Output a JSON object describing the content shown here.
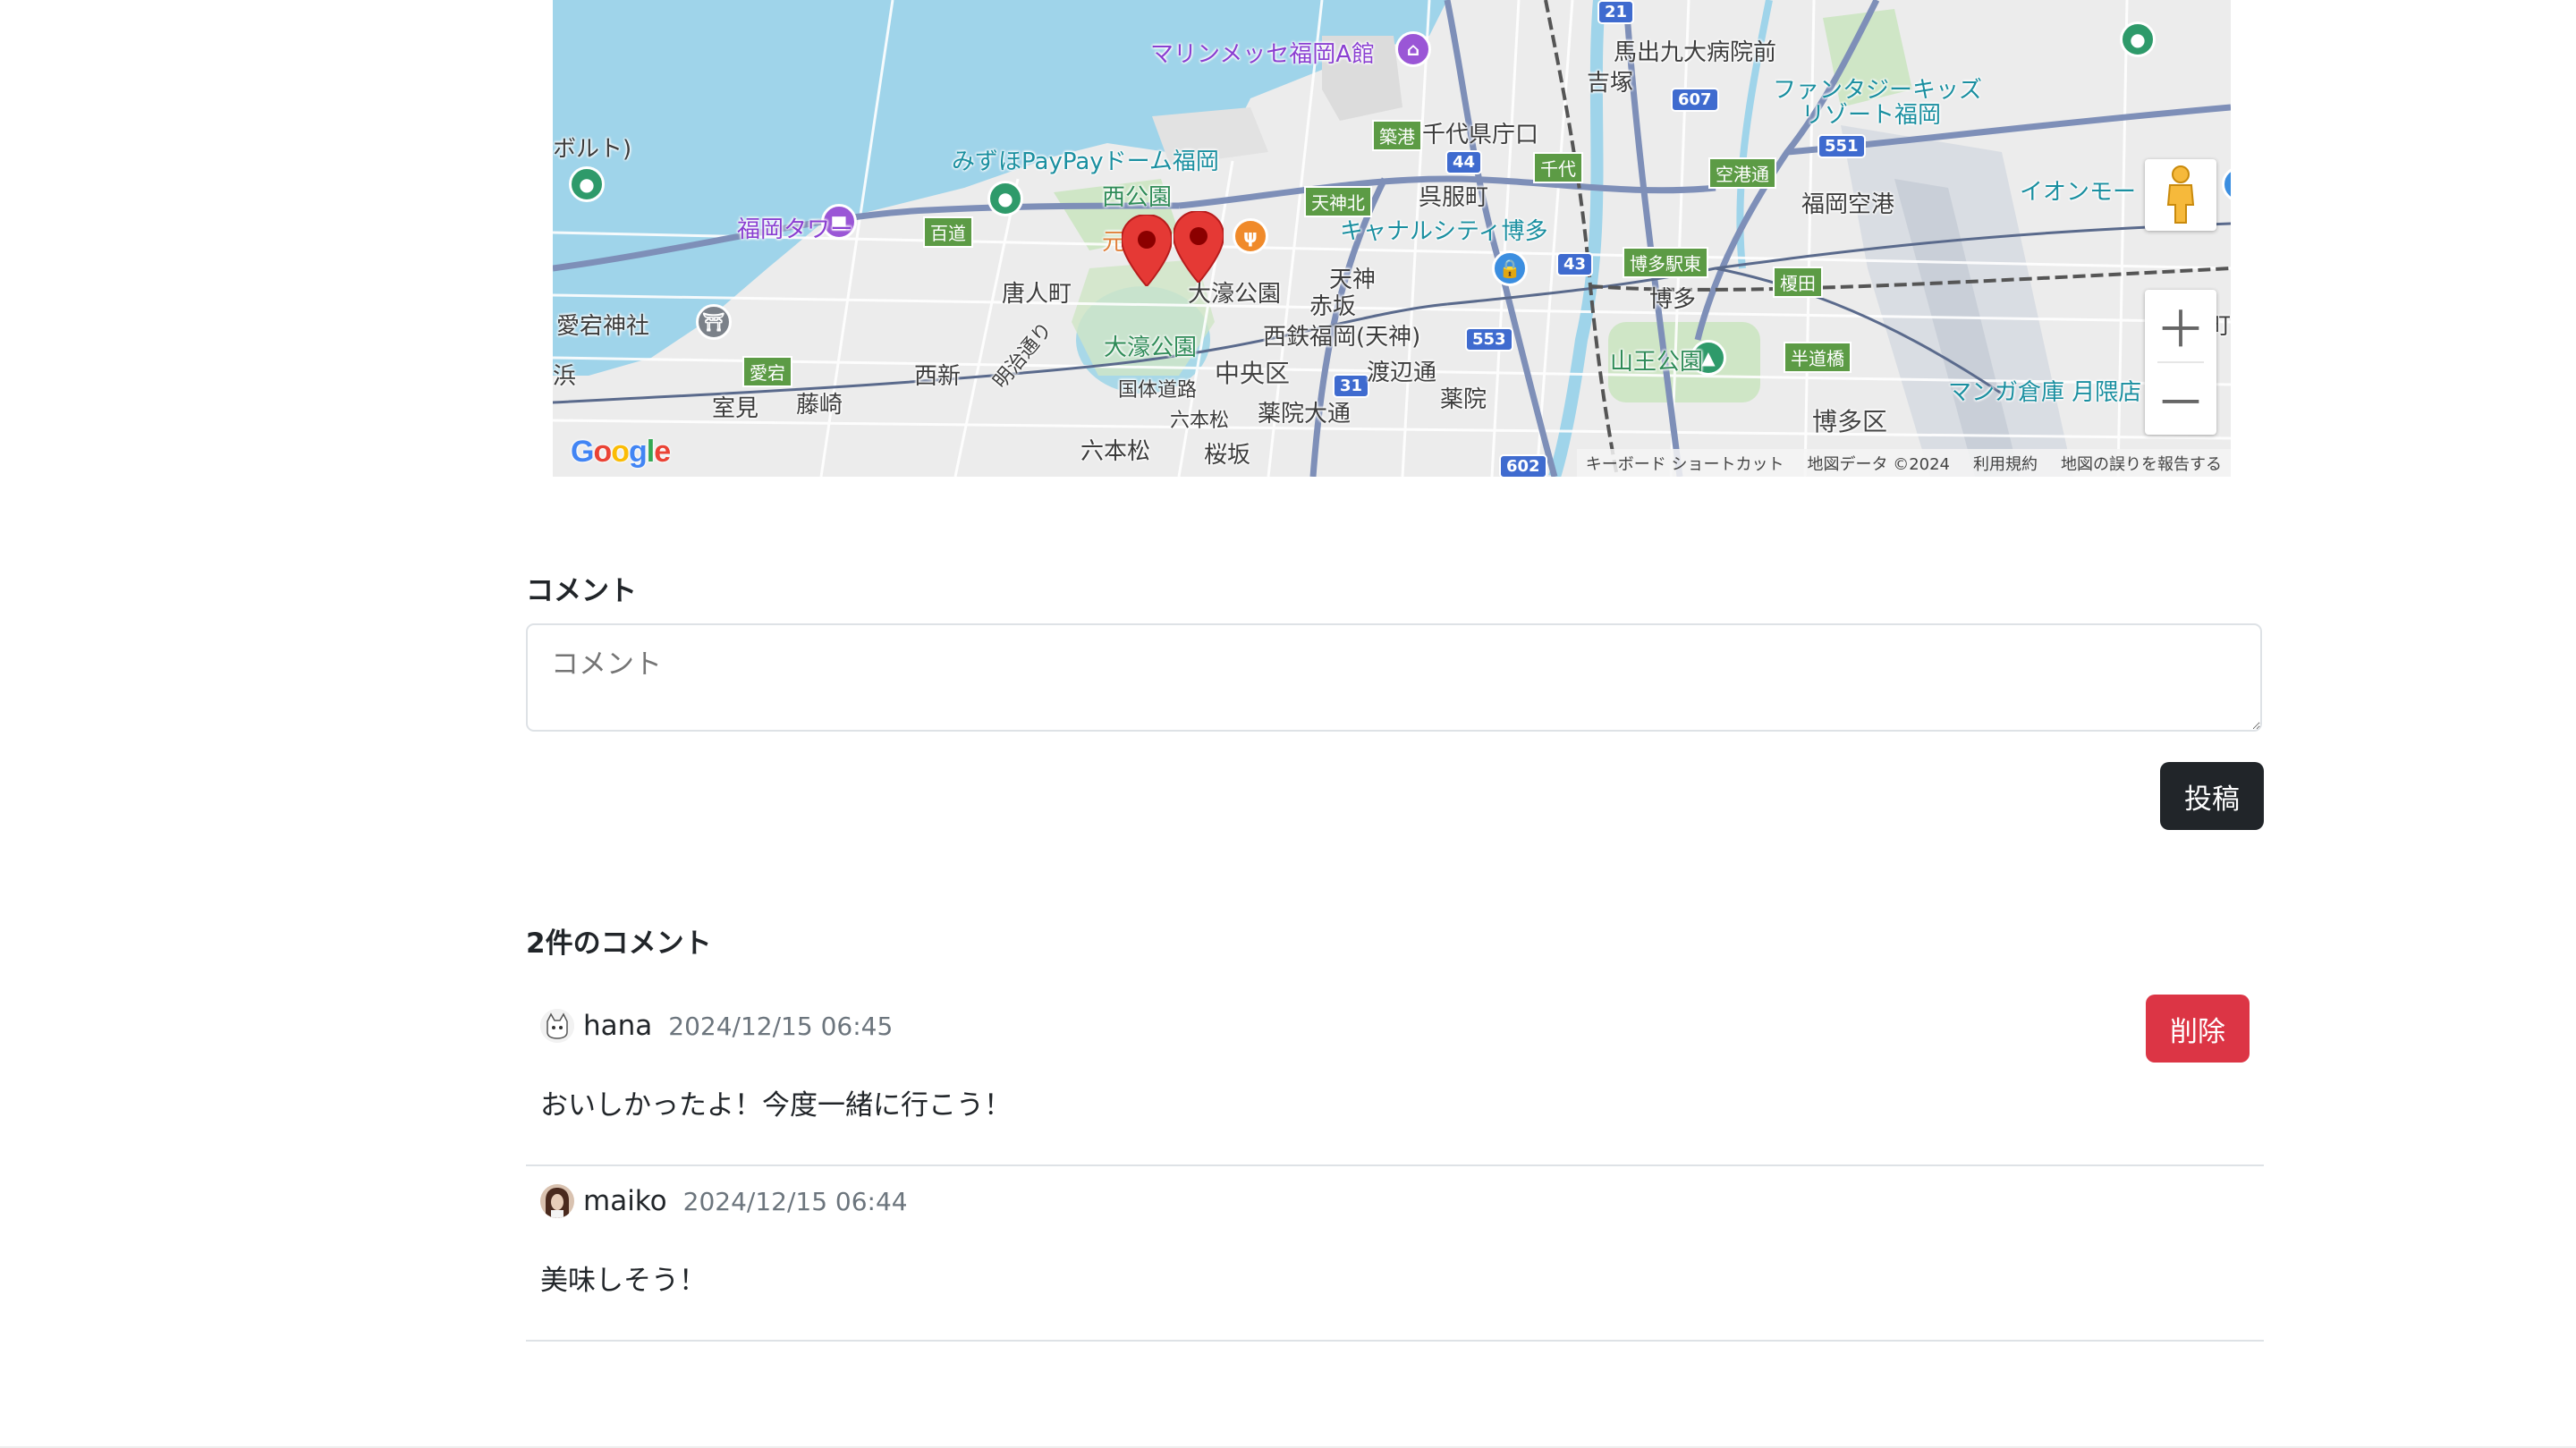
{
  "map": {
    "labels": [
      {
        "text": "マリンメッセ福岡A館",
        "cls": "purple"
      },
      {
        "text": "馬出九大病院前",
        "cls": ""
      },
      {
        "text": "吉塚",
        "cls": ""
      },
      {
        "text": "ファンタジーキッズ",
        "cls": "teal"
      },
      {
        "text": "リゾート福岡",
        "cls": "teal"
      },
      {
        "text": "みずほPayPayドーム福岡",
        "cls": "teal"
      },
      {
        "text": "千代県庁口",
        "cls": ""
      },
      {
        "text": "福岡タワー",
        "cls": "purple"
      },
      {
        "text": "西公園",
        "cls": "green"
      },
      {
        "text": "呉服町",
        "cls": ""
      },
      {
        "text": "福岡空港",
        "cls": ""
      },
      {
        "text": "イオンモー",
        "cls": "teal"
      },
      {
        "text": "キャナルシティ博多",
        "cls": "teal"
      },
      {
        "text": "天神",
        "cls": ""
      },
      {
        "text": "唐人町",
        "cls": ""
      },
      {
        "text": "大濠公園",
        "cls": ""
      },
      {
        "text": "赤坂",
        "cls": ""
      },
      {
        "text": "博多",
        "cls": ""
      },
      {
        "text": "西鉄福岡(天神)",
        "cls": ""
      },
      {
        "text": "大濠公園",
        "cls": "green"
      },
      {
        "text": "中央区",
        "cls": "big"
      },
      {
        "text": "渡辺通",
        "cls": ""
      },
      {
        "text": "西新",
        "cls": ""
      },
      {
        "text": "山王公園",
        "cls": "green"
      },
      {
        "text": "国体道路",
        "cls": "small"
      },
      {
        "text": "薬院",
        "cls": ""
      },
      {
        "text": "藤崎",
        "cls": ""
      },
      {
        "text": "室見",
        "cls": ""
      },
      {
        "text": "薬院大通",
        "cls": ""
      },
      {
        "text": "マンガ倉庫 月隈店",
        "cls": "teal"
      },
      {
        "text": "六本松",
        "cls": ""
      },
      {
        "text": "桜坂",
        "cls": ""
      },
      {
        "text": "博多区",
        "cls": "big"
      },
      {
        "text": "愛宕神社",
        "cls": ""
      },
      {
        "text": "浜",
        "cls": ""
      },
      {
        "text": "ボルト)",
        "cls": ""
      },
      {
        "text": "元",
        "cls": ""
      },
      {
        "text": "町",
        "cls": ""
      },
      {
        "text": "明治通り",
        "cls": "small"
      },
      {
        "text": "六本松",
        "cls": "small"
      }
    ],
    "station_tags": [
      "築港",
      "天神北",
      "千代",
      "空港通",
      "博多駅東",
      "榎田",
      "半道橋",
      "百道",
      "愛宕"
    ],
    "routes": [
      "21",
      "607",
      "44",
      "551",
      "43",
      "553",
      "31",
      "602"
    ],
    "google_logo": "Google",
    "footer": {
      "shortcuts": "キーボード ショートカット",
      "map_data": "地図データ ©2024",
      "terms": "利用規約",
      "report": "地図の誤りを報告する"
    }
  },
  "comment_form": {
    "label": "コメント",
    "placeholder": "コメント",
    "submit_label": "投稿"
  },
  "comments_section": {
    "count_heading": "2件のコメント",
    "delete_label": "削除",
    "comments": [
      {
        "user": "hana",
        "time": "2024/12/15 06:45",
        "body": "おいしかったよ！今度一緒に行こう！"
      },
      {
        "user": "maiko",
        "time": "2024/12/15 06:44",
        "body": "美味しそう！"
      }
    ]
  },
  "colors": {
    "water": "#9fd4ea",
    "land": "#ececec",
    "primary_dark": "#212529",
    "danger": "#dc3545",
    "muted": "#6c757d",
    "border": "#dee2e6"
  }
}
